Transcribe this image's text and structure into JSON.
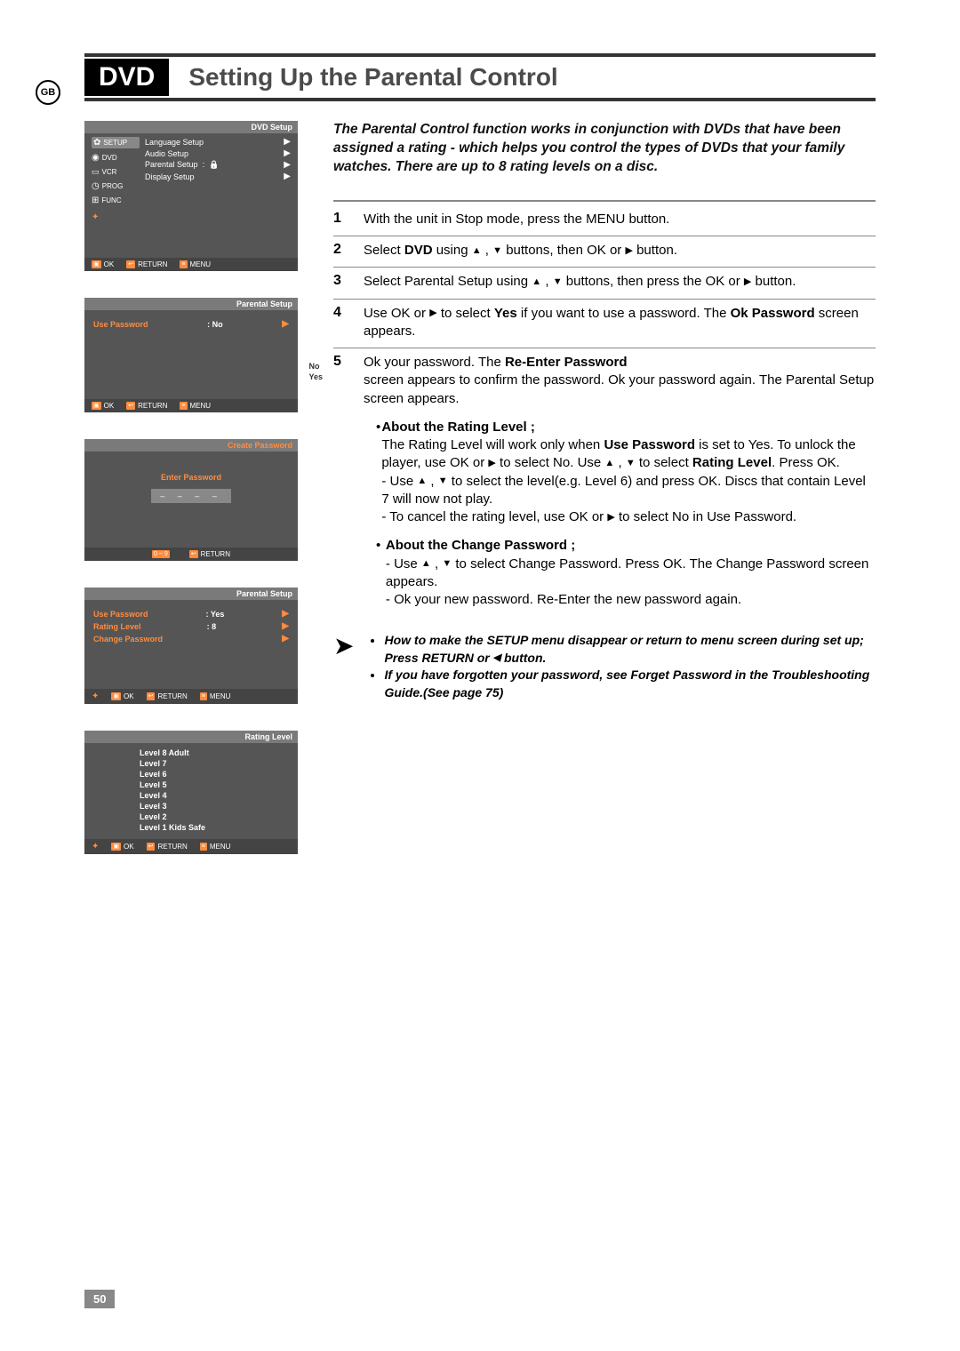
{
  "badge": "GB",
  "header": {
    "section": "DVD",
    "title": "Setting Up the Parental Control"
  },
  "intro": "The Parental Control function works in conjunction with DVDs that have been assigned a rating - which helps you control the types of DVDs that your family watches. There are up to 8 rating levels on a disc.",
  "steps": {
    "s1": {
      "num": "1",
      "text": "With the unit in Stop mode, press the MENU button."
    },
    "s2": {
      "num": "2",
      "pre": "Select ",
      "bold": "DVD",
      "post1": " using ",
      "post2": " buttons, then OK or ",
      "post3": " button."
    },
    "s3": {
      "num": "3",
      "pre": "Select Parental Setup using ",
      "post1": " buttons, then press the OK or ",
      "post2": " button."
    },
    "s4": {
      "num": "4",
      "pre": "Use OK or ",
      "mid": " to select ",
      "bold": "Yes",
      "post": " if you want to use a password. The ",
      "bold2": "Ok Password",
      "tail": " screen appears."
    },
    "s5": {
      "num": "5",
      "pre": "Ok your password. The ",
      "bold": "Re-Enter Password",
      "post": " screen appears to confirm the password. Ok your password again. The Parental Setup screen appears."
    }
  },
  "sub1": {
    "title": "About the Rating Level ;",
    "line1a": "The Rating Level will work only when ",
    "line1b": "Use Password",
    "line1c": " is set to Yes. To unlock the player, use OK or ",
    "line1d": " to select No. Use ",
    "line1e": " to select ",
    "line1f": "Rating Level",
    "line1g": ". Press OK.",
    "dash1a": "- Use ",
    "dash1b": " to select the level(e.g. Level 6) and press OK. Discs that contain Level 7 will now not play.",
    "dash2a": "- To cancel the rating level, use OK or ",
    "dash2b": " to select No in Use Password."
  },
  "sub2": {
    "title": "About the Change Password ;",
    "dash1a": "- Use ",
    "dash1b": " to select Change Password. Press OK. The Change Password screen appears.",
    "dash2": "- Ok your new password. Re-Enter the new password again."
  },
  "notes": {
    "n1a": "How to make the SETUP menu disappear or return to menu screen during set up; Press RETURN or ",
    "n1b": " button.",
    "n2": "If you have forgotten your password, see Forget Password in the Troubleshooting Guide.(See page 75)"
  },
  "osd1": {
    "title": "DVD Setup",
    "sidebar": [
      "SETUP",
      "DVD",
      "VCR",
      "PROG",
      "FUNC"
    ],
    "menu": [
      "Language Setup",
      "Audio Setup",
      "Parental Setup",
      "Display Setup"
    ],
    "colon": ":"
  },
  "osd2": {
    "title": "Parental Setup",
    "row_left": "Use Password",
    "row_mid": ":   No",
    "side": {
      "no": "No",
      "yes": "Yes"
    }
  },
  "osd3": {
    "title": "Create Password",
    "enter": "Enter Password",
    "dashes": "– – – –",
    "footer_range": "0 ~ 9"
  },
  "osd4": {
    "title": "Parental Setup",
    "rows": [
      {
        "left": "Use Password",
        "mid": ":   Yes"
      },
      {
        "left": "Rating Level",
        "mid": ":   8"
      },
      {
        "left": "Change Password",
        "mid": ""
      }
    ]
  },
  "osd5": {
    "title": "Rating Level",
    "levels": [
      "Level  8  Adult",
      "Level  7",
      "Level  6",
      "Level  5",
      "Level  4",
      "Level  3",
      "Level  2",
      "Level  1  Kids Safe"
    ]
  },
  "footer": {
    "ok": "OK",
    "ret": "RETURN",
    "menu": "MENU"
  },
  "page_num": "50"
}
